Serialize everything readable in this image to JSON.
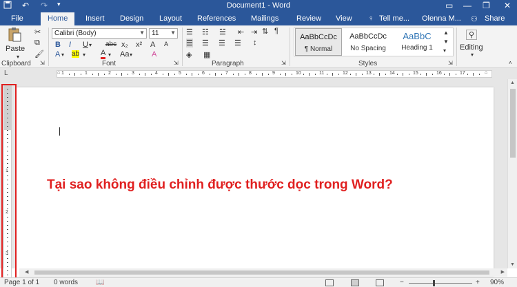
{
  "window": {
    "title": "Document1 - Word",
    "minimize": "—",
    "restore": "❐",
    "close": "✕",
    "ribbon_display": "▭"
  },
  "quick_access": {
    "save": "💾",
    "undo": "↶",
    "redo": "↷"
  },
  "tabs": [
    "File",
    "Home",
    "Insert",
    "Design",
    "Layout",
    "References",
    "Mailings",
    "Review",
    "View"
  ],
  "active_tab": "Home",
  "tell_me": "Tell me...",
  "user": "Olenna M...",
  "share": "Share",
  "ribbon": {
    "clipboard": {
      "label": "Clipboard",
      "paste": "Paste"
    },
    "font": {
      "label": "Font",
      "family": "Calibri (Body)",
      "size": "11",
      "grow": "A˄",
      "shrink": "A˅",
      "case": "Aa",
      "clear": "A",
      "bold": "B",
      "italic": "I",
      "underline": "U",
      "strike": "abc",
      "subscript": "x₂",
      "superscript": "x²",
      "effects": "A",
      "highlight": "ab",
      "color": "A",
      "case2": "Aa",
      "grow2": "A",
      "shrink2": "A"
    },
    "paragraph": {
      "label": "Paragraph"
    },
    "styles": {
      "label": "Styles",
      "items": [
        {
          "sample": "AaBbCcDc",
          "name": "¶ Normal"
        },
        {
          "sample": "AaBbCcDc",
          "name": "No Spacing"
        },
        {
          "sample": "AaBbC",
          "name": "Heading 1"
        }
      ]
    },
    "editing": {
      "label": "Editing"
    }
  },
  "ruler_numbers": [
    "1",
    "1",
    "2",
    "3",
    "4",
    "5",
    "6",
    "7",
    "8",
    "9",
    "10",
    "11",
    "12",
    "13",
    "14",
    "15",
    "16",
    "17"
  ],
  "vruler_numbers": [
    "1",
    "2",
    "3"
  ],
  "document": {
    "headline": "Tại sao không điều chỉnh được thước dọc trong Word?"
  },
  "status": {
    "page": "Page 1 of 1",
    "words": "0 words",
    "zoom": "90%",
    "zoom_minus": "−",
    "zoom_plus": "+"
  },
  "colors": {
    "titlebar": "#2b579a",
    "headline": "#e02020",
    "highlight_box": "#e02020"
  }
}
